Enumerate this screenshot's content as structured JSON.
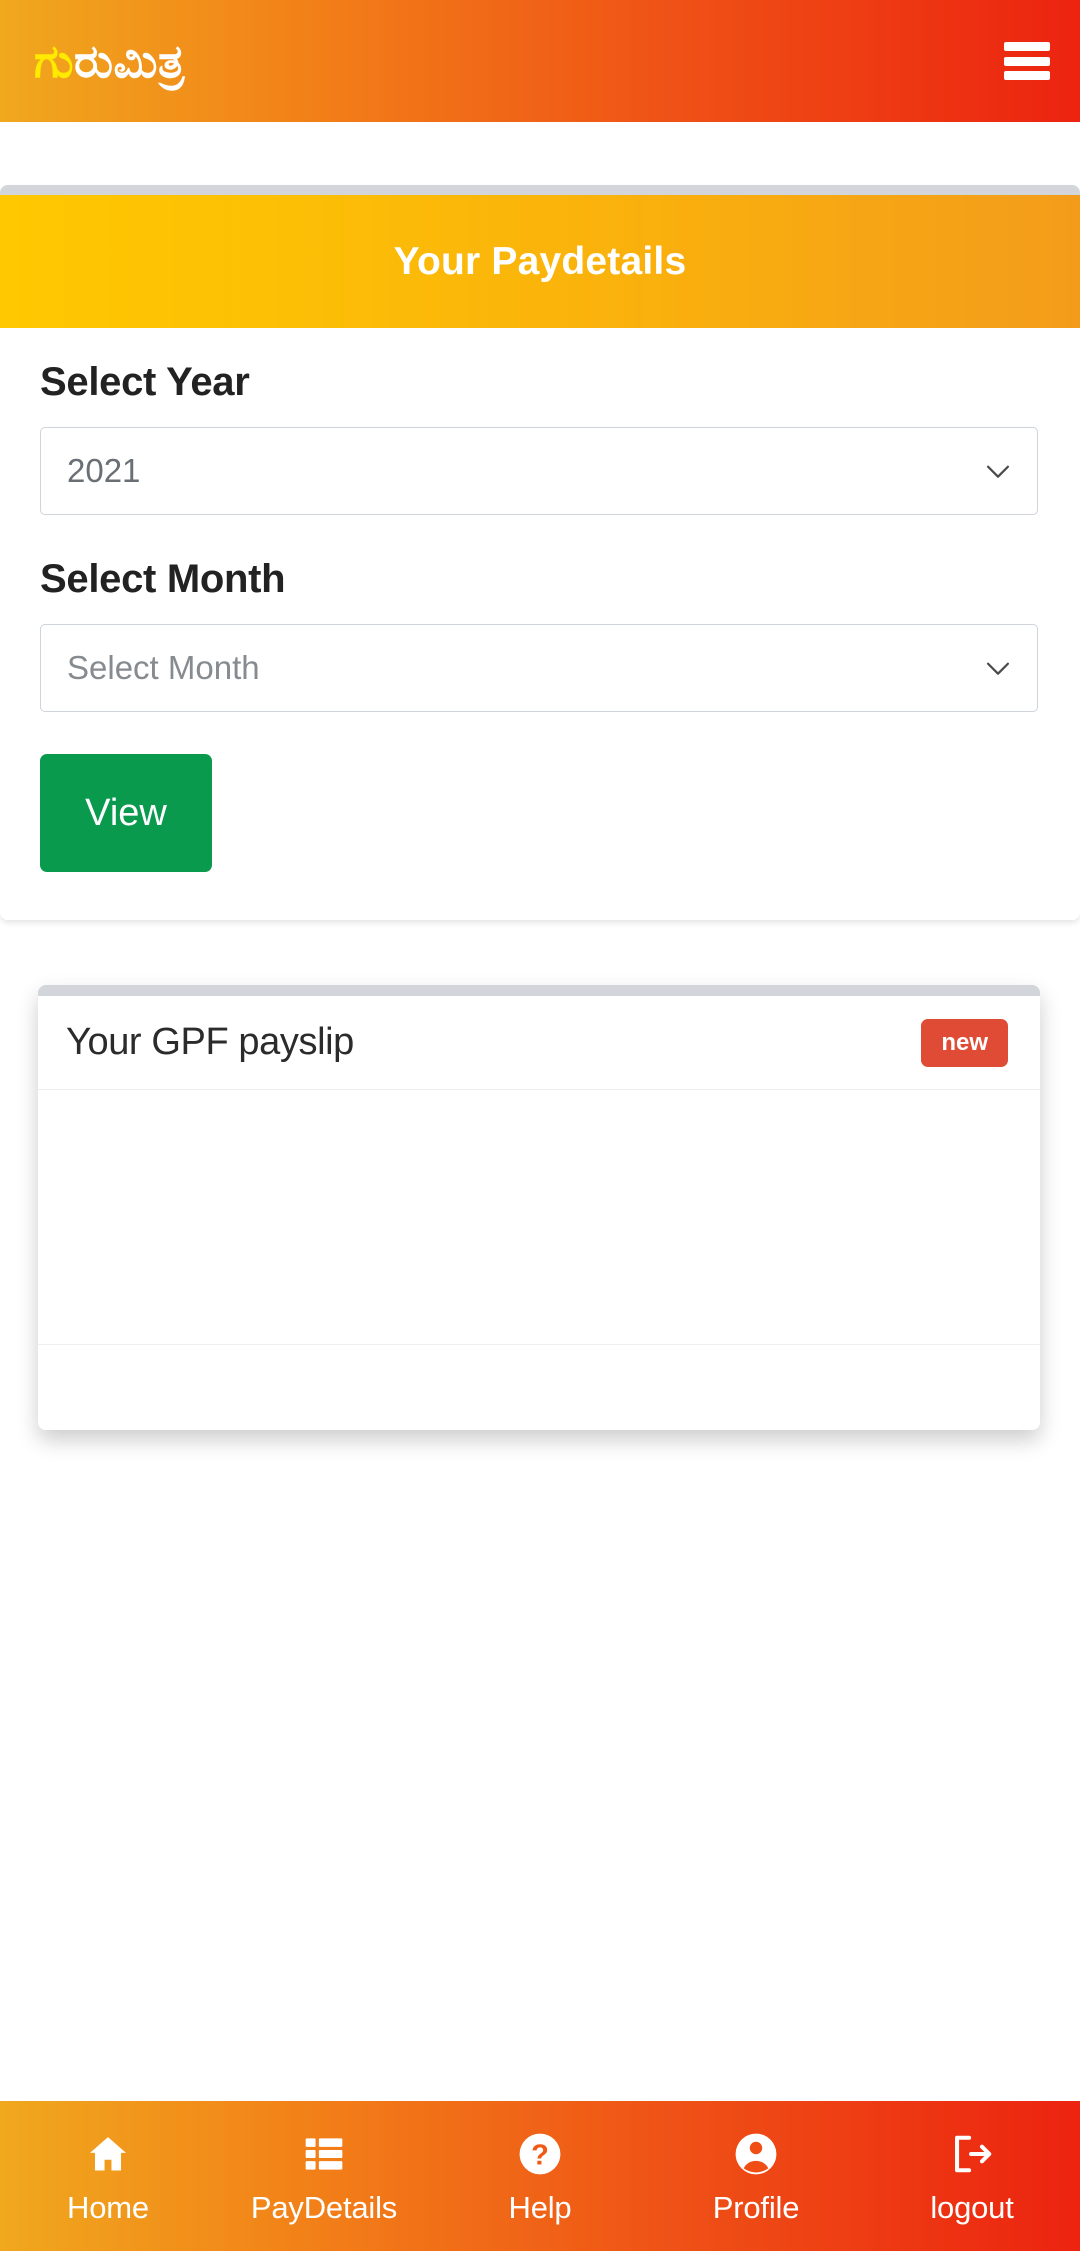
{
  "header": {
    "brand_accent": "ಗು",
    "brand_rest": "ರುಮಿತ್ರ",
    "menu_icon": "hamburger-menu-icon",
    "gradient_start": "#f0a81e",
    "gradient_end": "#ec2310"
  },
  "paydetails_card": {
    "title": "Your Paydetails",
    "title_gradient_start": "#ffc800",
    "title_gradient_end": "#f39c1b",
    "year": {
      "label": "Select Year",
      "value": "2021",
      "chevron_icon": "chevron-down-icon"
    },
    "month": {
      "label": "Select Month",
      "value": "Select Month",
      "placeholder": "Select Month",
      "chevron_icon": "chevron-down-icon"
    },
    "view_button": {
      "label": "View",
      "color": "#099a4e"
    }
  },
  "payslip_card": {
    "title": "Your GPF payslip",
    "badge": "new",
    "badge_color": "#e04b35"
  },
  "bottom_nav": {
    "items": [
      {
        "label": "Home",
        "icon": "home-icon"
      },
      {
        "label": "PayDetails",
        "icon": "list-table-icon"
      },
      {
        "label": "Help",
        "icon": "question-circle-icon"
      },
      {
        "label": "Profile",
        "icon": "person-circle-icon"
      },
      {
        "label": "logout",
        "icon": "logout-arrow-icon"
      }
    ]
  }
}
